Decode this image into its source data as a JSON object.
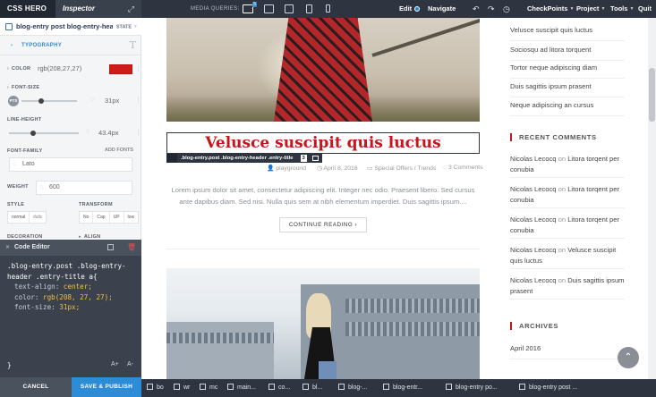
{
  "topbar": {
    "brand": "CSS HERO",
    "inspector_tab": "Inspector",
    "media_queries_label": "MEDIA QUERIES:",
    "media_query_badge": "5",
    "edit": "Edit",
    "navigate": "Navigate",
    "checkpoints": "CheckPoints",
    "project": "Project",
    "tools": "Tools",
    "quit": "Quit"
  },
  "inspector": {
    "selector": "blog-entry post blog-entry-header",
    "state": "STATE",
    "section": "TYPOGRAPHY",
    "color_label": "COLOR",
    "color_value": "rgb(208,27,27)",
    "color_hex": "#d01b1b",
    "font_size_label": "FONT-SIZE",
    "font_size_unit": "PTS",
    "font_size_value": "31px",
    "font_size_fraction": 0.35,
    "line_height_label": "LINE-HEIGHT",
    "line_height_value": "43.4px",
    "line_height_fraction": 0.35,
    "font_family_label": "FONT-FAMILY",
    "add_fonts": "ADD FONTS",
    "font_family_value": "Lato",
    "weight_label": "WEIGHT",
    "weight_value": "600",
    "style_label": "STYLE",
    "transform_label": "TRANSFORM",
    "style_options": [
      "normal",
      "italic"
    ],
    "transform_options": [
      "No",
      "Cap",
      "UP",
      "low"
    ],
    "decoration_label": "DECORATION",
    "align_label": "ALIGN"
  },
  "code_editor": {
    "title": "Code Editor",
    "selector_line1": ".blog-entry.post .blog-entry-",
    "selector_line2": "header .entry-title a{",
    "line1_prop": "text-align: ",
    "line1_val": "center;",
    "line2_prop": "color: ",
    "line2_val": "rgb(208, 27, 27);",
    "line3_prop": "font-size: ",
    "line3_val": "31px;",
    "close_brace": "}",
    "zoom_in": "A+",
    "zoom_out": "A-"
  },
  "actions": {
    "cancel": "CANCEL",
    "save_publish": "SAVE & PUBLISH"
  },
  "breadcrumbs": [
    "bo",
    "wr",
    "mc",
    "main...",
    "co...",
    "bl...",
    "blog-...",
    "blog-entr...",
    "blog-entry po...",
    "blog-entry post ..."
  ],
  "post": {
    "title": "Velusce suscipit quis luctus",
    "selector_tag": ".blog-entry.post .blog-entry-header .entry-title",
    "selector_tag_count": "3",
    "author": "playground",
    "date": "April 8, 2016",
    "category": "Special Offers / Trends",
    "comments": "3 Comments",
    "excerpt": "Lorem ipsum dolor sit amet, consectetur adipiscing elit. Integer nec odio. Praesent libero. Sed cursus ante dapibus diam. Sed nisi. Nulla quis sem at nibh elementum imperdiet. Duis sagittis ipsum....",
    "continue": "CONTINUE READING"
  },
  "sidebar": {
    "recent_posts": [
      "Velusce suscipit quis luctus",
      "Sociosqu ad litora torquent",
      "Tortor neque adipiscing diam",
      "Duis sagittis ipsum prasent",
      "Neque adipiscing an cursus"
    ],
    "recent_comments_title": "RECENT COMMENTS",
    "comments": [
      {
        "author": "Nicolas Lecocq",
        "on": "on",
        "post": "Litora torqent per conubia"
      },
      {
        "author": "Nicolas Lecocq",
        "on": "on",
        "post": "Litora torqent per conubia"
      },
      {
        "author": "Nicolas Lecocq",
        "on": "on",
        "post": "Litora torqent per conubia"
      },
      {
        "author": "Nicolas Lecocq",
        "on": "on",
        "post": "Velusce suscipit quis luctus"
      },
      {
        "author": "Nicolas Lecocq",
        "on": "on",
        "post": "Duis sagittis ipsum prasent"
      }
    ],
    "archives_title": "ARCHIVES",
    "archive_item": "April 2016"
  },
  "colors": {
    "accent_blue": "#2e8bd6",
    "title_red": "#c4161c",
    "toolbar": "#2e3540"
  }
}
